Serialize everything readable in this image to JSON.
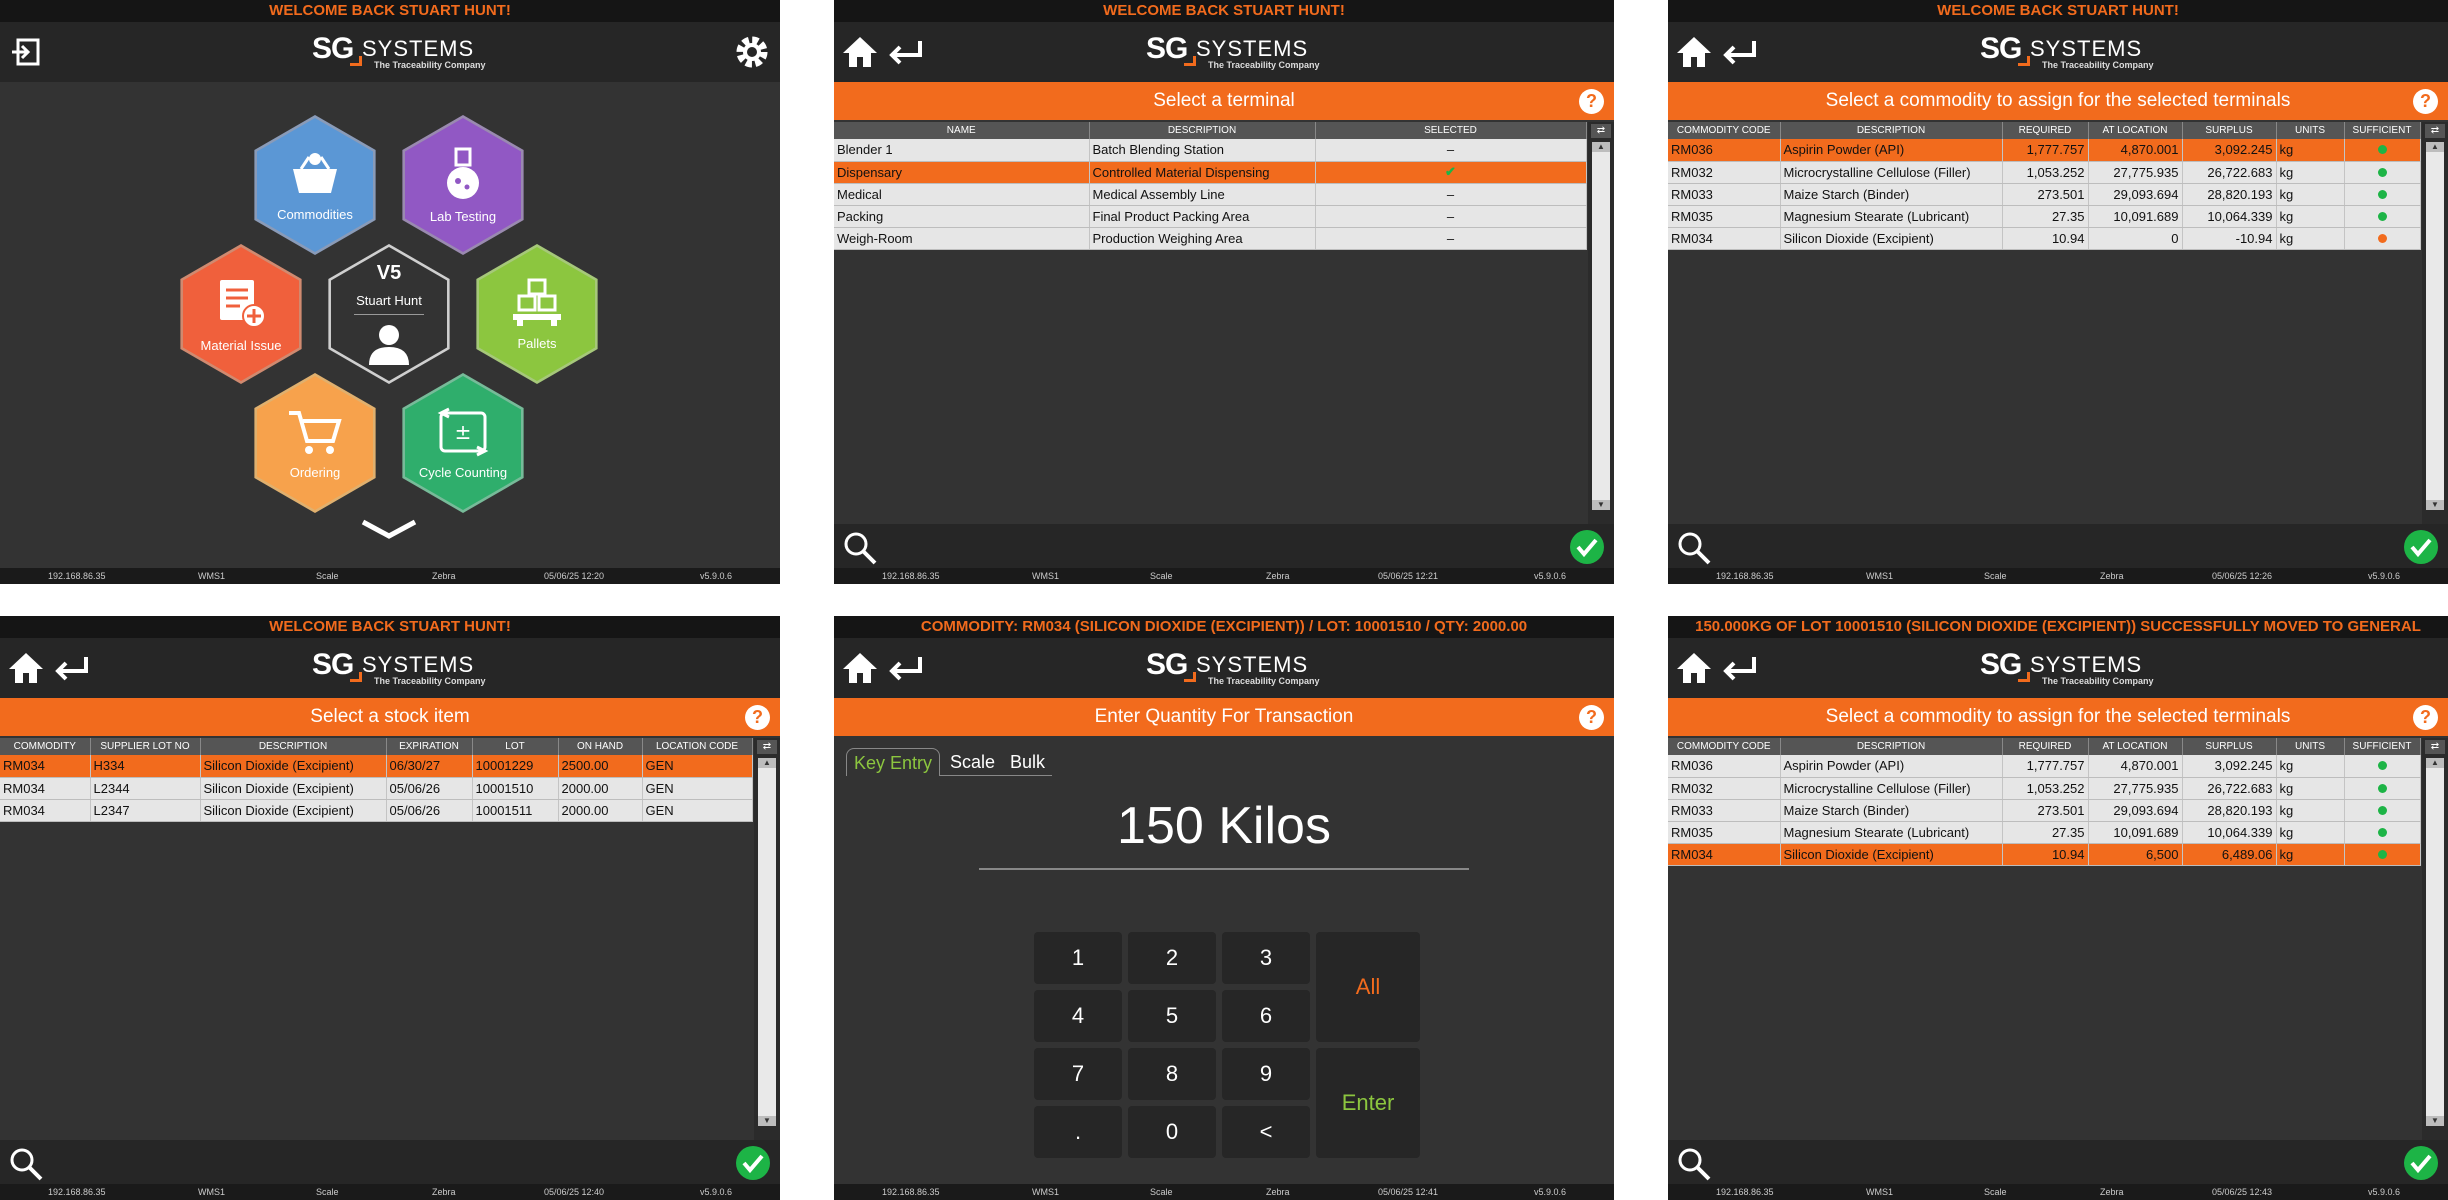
{
  "brand": {
    "sg": "SG",
    "systems": "SYSTEMS",
    "tagline": "The Traceability Company"
  },
  "colors": {
    "accent": "#f26b1d",
    "ok": "#1db446"
  },
  "screens": {
    "menu": {
      "banner": "WELCOME BACK STUART HUNT!",
      "tiles": {
        "commodities": "Commodities",
        "lab": "Lab Testing",
        "material": "Material Issue",
        "pallets": "Pallets",
        "ordering": "Ordering",
        "cycle": "Cycle Counting"
      },
      "center": {
        "version": "V5",
        "user": "Stuart Hunt"
      },
      "status": {
        "ip": "192.168.86.35",
        "site": "WMS1",
        "scale": "Scale",
        "printer": "Zebra",
        "datetime": "05/06/25 12:20",
        "version": "v5.9.0.6"
      }
    },
    "terminal": {
      "banner": "WELCOME BACK STUART HUNT!",
      "title": "Select a terminal",
      "columns": [
        "NAME",
        "DESCRIPTION",
        "SELECTED"
      ],
      "rows": [
        {
          "name": "Blender 1",
          "description": "Batch Blending Station",
          "selected": "–"
        },
        {
          "name": "Dispensary",
          "description": "Controlled Material Dispensing",
          "selected": "✔"
        },
        {
          "name": "Medical",
          "description": "Medical Assembly Line",
          "selected": "–"
        },
        {
          "name": "Packing",
          "description": "Final Product Packing Area",
          "selected": "–"
        },
        {
          "name": "Weigh-Room",
          "description": "Production Weighing Area",
          "selected": "–"
        }
      ],
      "status": {
        "ip": "192.168.86.35",
        "site": "WMS1",
        "scale": "Scale",
        "printer": "Zebra",
        "datetime": "05/06/25 12:21",
        "version": "v5.9.0.6"
      }
    },
    "commodity1": {
      "banner": "WELCOME BACK STUART HUNT!",
      "title": "Select a commodity to assign for the selected terminals",
      "columns": [
        "COMMODITY CODE",
        "DESCRIPTION",
        "REQUIRED",
        "AT LOCATION",
        "SURPLUS",
        "UNITS",
        "SUFFICIENT"
      ],
      "rows": [
        {
          "code": "RM036",
          "description": "Aspirin Powder (API)",
          "required": "1,777.757",
          "at_location": "4,870.001",
          "surplus": "3,092.245",
          "units": "kg"
        },
        {
          "code": "RM032",
          "description": "Microcrystalline Cellulose (Filler)",
          "required": "1,053.252",
          "at_location": "27,775.935",
          "surplus": "26,722.683",
          "units": "kg"
        },
        {
          "code": "RM033",
          "description": "Maize Starch (Binder)",
          "required": "273.501",
          "at_location": "29,093.694",
          "surplus": "28,820.193",
          "units": "kg"
        },
        {
          "code": "RM035",
          "description": "Magnesium Stearate (Lubricant)",
          "required": "27.35",
          "at_location": "10,091.689",
          "surplus": "10,064.339",
          "units": "kg"
        },
        {
          "code": "RM034",
          "description": "Silicon Dioxide (Excipient)",
          "required": "10.94",
          "at_location": "0",
          "surplus": "-10.94",
          "units": "kg"
        }
      ],
      "status": {
        "ip": "192.168.86.35",
        "site": "WMS1",
        "scale": "Scale",
        "printer": "Zebra",
        "datetime": "05/06/25 12:26",
        "version": "v5.9.0.6"
      }
    },
    "stock": {
      "banner": "WELCOME BACK STUART HUNT!",
      "title": "Select a stock item",
      "columns": [
        "COMMODITY",
        "SUPPLIER LOT NO",
        "DESCRIPTION",
        "EXPIRATION",
        "LOT",
        "ON HAND",
        "LOCATION CODE"
      ],
      "rows": [
        {
          "commodity": "RM034",
          "supplier_lot": "H334",
          "description": "Silicon Dioxide (Excipient)",
          "expiration": "06/30/27",
          "lot": "10001229",
          "on_hand": "2500.00",
          "location": "GEN"
        },
        {
          "commodity": "RM034",
          "supplier_lot": "L2344",
          "description": "Silicon Dioxide (Excipient)",
          "expiration": "05/06/26",
          "lot": "10001510",
          "on_hand": "2000.00",
          "location": "GEN"
        },
        {
          "commodity": "RM034",
          "supplier_lot": "L2347",
          "description": "Silicon Dioxide (Excipient)",
          "expiration": "05/06/26",
          "lot": "10001511",
          "on_hand": "2000.00",
          "location": "GEN"
        }
      ],
      "status": {
        "ip": "192.168.86.35",
        "site": "WMS1",
        "scale": "Scale",
        "printer": "Zebra",
        "datetime": "05/06/25 12:40",
        "version": "v5.9.0.6"
      }
    },
    "quantity": {
      "banner": "COMMODITY: RM034 (SILICON DIOXIDE (EXCIPIENT)) / LOT: 10001510 / QTY: 2000.00",
      "title": "Enter Quantity For Transaction",
      "tabs": [
        "Key Entry",
        "Scale",
        "Bulk"
      ],
      "value": "150 Kilos",
      "keys": [
        "1",
        "2",
        "3",
        "4",
        "5",
        "6",
        "7",
        "8",
        "9",
        ".",
        "0",
        "<"
      ],
      "all": "All",
      "enter": "Enter",
      "status": {
        "ip": "192.168.86.35",
        "site": "WMS1",
        "scale": "Scale",
        "printer": "Zebra",
        "datetime": "05/06/25 12:41",
        "version": "v5.9.0.6"
      }
    },
    "commodity2": {
      "banner": "150.000KG OF LOT 10001510 (SILICON DIOXIDE (EXCIPIENT)) SUCCESSFULLY MOVED TO GENERAL",
      "title": "Select a commodity to assign for the selected terminals",
      "columns": [
        "COMMODITY CODE",
        "DESCRIPTION",
        "REQUIRED",
        "AT LOCATION",
        "SURPLUS",
        "UNITS",
        "SUFFICIENT"
      ],
      "rows": [
        {
          "code": "RM036",
          "description": "Aspirin Powder (API)",
          "required": "1,777.757",
          "at_location": "4,870.001",
          "surplus": "3,092.245",
          "units": "kg"
        },
        {
          "code": "RM032",
          "description": "Microcrystalline Cellulose (Filler)",
          "required": "1,053.252",
          "at_location": "27,775.935",
          "surplus": "26,722.683",
          "units": "kg"
        },
        {
          "code": "RM033",
          "description": "Maize Starch (Binder)",
          "required": "273.501",
          "at_location": "29,093.694",
          "surplus": "28,820.193",
          "units": "kg"
        },
        {
          "code": "RM035",
          "description": "Magnesium Stearate (Lubricant)",
          "required": "27.35",
          "at_location": "10,091.689",
          "surplus": "10,064.339",
          "units": "kg"
        },
        {
          "code": "RM034",
          "description": "Silicon Dioxide (Excipient)",
          "required": "10.94",
          "at_location": "6,500",
          "surplus": "6,489.06",
          "units": "kg"
        }
      ],
      "status": {
        "ip": "192.168.86.35",
        "site": "WMS1",
        "scale": "Scale",
        "printer": "Zebra",
        "datetime": "05/06/25 12:43",
        "version": "v5.9.0.6"
      }
    }
  }
}
